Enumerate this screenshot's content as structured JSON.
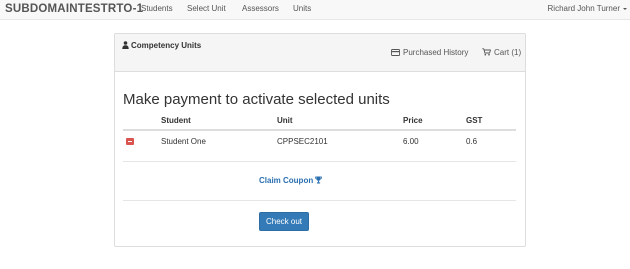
{
  "navbar": {
    "brand": "SUBDOMAINTESTRTO-1",
    "links": [
      "Students",
      "Select Unit",
      "Assessors",
      "Units"
    ],
    "user": "Richard John Turner"
  },
  "panel": {
    "title": "Competency Units",
    "purchased_history": "Purchased History",
    "cart": "Cart (1)"
  },
  "payment": {
    "heading": "Make payment to activate selected units",
    "columns": [
      "Student",
      "Unit",
      "Price",
      "GST"
    ],
    "rows": [
      {
        "student": "Student One",
        "unit": "CPPSEC2101",
        "price": "6.00",
        "gst": "0.6"
      }
    ],
    "coupon_label": "Claim Coupon",
    "checkout_label": "Check out"
  },
  "colors": {
    "primary": "#337ab7",
    "danger": "#d9534f",
    "link": "#2a6fb0"
  },
  "icons": [
    "user-icon",
    "credit-card-icon",
    "shopping-cart-icon",
    "trophy-icon",
    "minus-icon",
    "caret-down-icon"
  ]
}
